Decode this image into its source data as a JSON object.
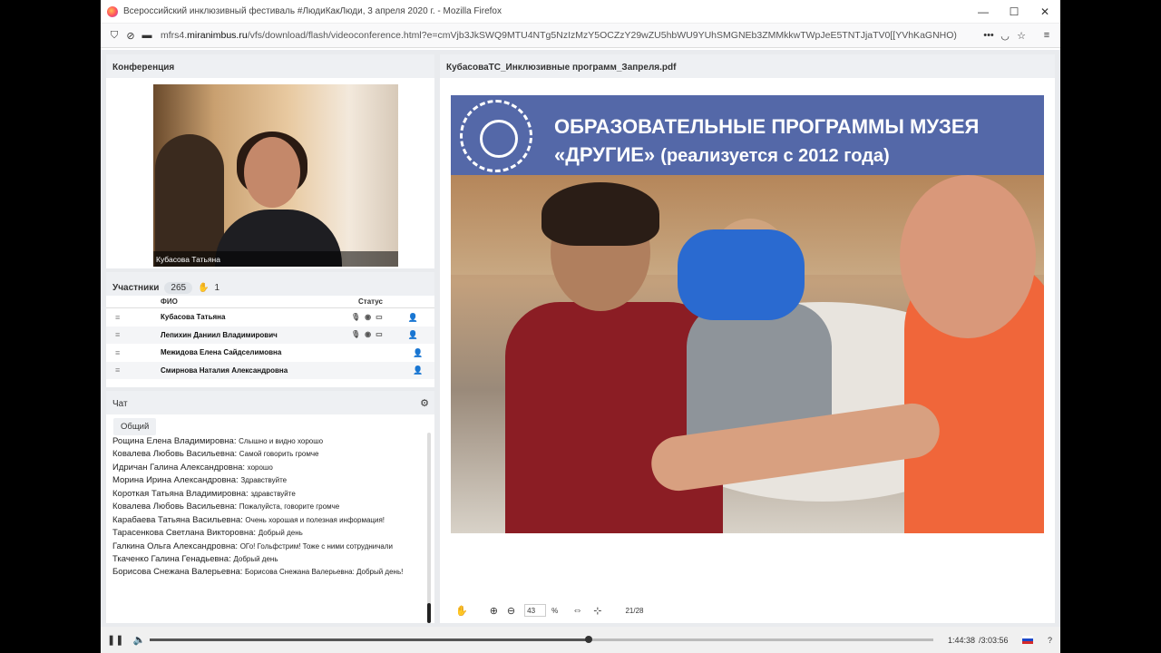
{
  "window": {
    "title": "Всероссийский инклюзивный фестиваль #ЛюдиКакЛюди, 3 апреля 2020 г. - Mozilla Firefox"
  },
  "address": {
    "domain": "mfrs4.",
    "domain_bold": "miranimbus.ru",
    "path": "/vfs/download/flash/videoconference.html?e=cmVjb3JkSWQ9MTU4NTg5NzIzMzY5OCZzY29wZU5hbWU9YUhSMGNEb3ZMMkkwTWpJeE5TNTJjaTV0[[YVhKaGNHO)"
  },
  "conference": {
    "title": "Конференция",
    "speaker_label": "Кубасова Татьяна"
  },
  "participants": {
    "title": "Участники",
    "count": "265",
    "hands": "1",
    "col_name": "ФИО",
    "col_status": "Статус",
    "rows": [
      {
        "name": "Кубасова Татьяна"
      },
      {
        "name": "Лепихин Даниил Владимирович"
      },
      {
        "name": "Межидова Елена Сайдселимовна"
      },
      {
        "name": "Смирнова Наталия Александровна"
      }
    ]
  },
  "chat": {
    "title": "Чат",
    "tab": "Общий",
    "messages": [
      {
        "author": "Рощина Елена Владимировна:",
        "text": "Слышно и видно хорошо"
      },
      {
        "author": "Ковалева Любовь Васильевна:",
        "text": "Самой говорить громче"
      },
      {
        "author": "Идричан Галина Александровна:",
        "text": "хорошо"
      },
      {
        "author": "Морина Ирина Александровна:",
        "text": "Здравствуйте"
      },
      {
        "author": "Короткая Татьяна Владимировна:",
        "text": "здравствуйте"
      },
      {
        "author": "Ковалева Любовь Васильевна:",
        "text": "Пожалуйста, говорите громче"
      },
      {
        "author": "Карабаева Татьяна Васильевна:",
        "text": "Очень хорошая и полезная информация!"
      },
      {
        "author": "Тарасенкова Светлана Викторовна:",
        "text": "Добрый день"
      },
      {
        "author": "Галкина Ольга Александровна:",
        "text": "ОГо! Гольфстрим! Тоже с ними сотрудничали"
      },
      {
        "author": "Ткаченко Галина Генадьевна:",
        "text": "Добрый день"
      },
      {
        "author": "Борисова Снежана Валерьевна:",
        "text": "Борисова Снежана Валерьевна: Добрый день!"
      }
    ]
  },
  "document": {
    "filename": "КубасоваТС_Инклюзивные программ_Запреля.pdf",
    "slide_line1": "ОБРАЗОВАТЕЛЬНЫЕ ПРОГРАММЫ МУЗЕЯ",
    "slide_line2a": "«ДРУГИЕ»",
    "slide_line2b": "(реализуется с 2012 года)",
    "zoom_value": "43",
    "zoom_unit": "%",
    "page": "21/28"
  },
  "player": {
    "time_current": "1:44:38",
    "time_total": "/3:03:56",
    "progress": 0.56,
    "help": "?"
  },
  "colors": {
    "banner": "#5468a8",
    "accent": "#1e1e22"
  }
}
